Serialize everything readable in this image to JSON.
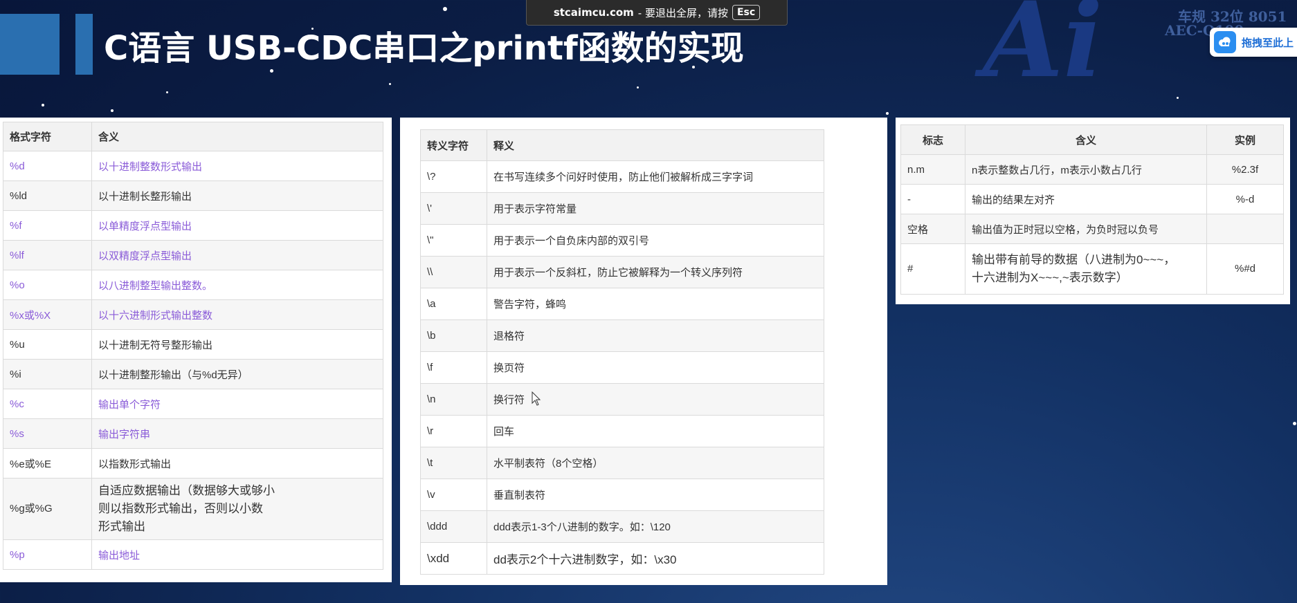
{
  "slide_title": "C语言 USB-CDC串口之printf函数的实现",
  "fullscreen_notice": {
    "domain": "stcaimcu.com",
    "text": "- 要退出全屏，请按",
    "key": "Esc"
  },
  "brand": {
    "big": "Ai",
    "line1": "车规 32位 8051",
    "line2": "AEC-Q100"
  },
  "drag_button": {
    "label": "拖拽至此上",
    "icon": "cloud-icon"
  },
  "format_table": {
    "headers": [
      "格式字符",
      "含义"
    ],
    "rows": [
      {
        "code": "%d",
        "meaning": "以十进制整数形式输出"
      },
      {
        "code": "%ld",
        "meaning": "以十进制长整形输出"
      },
      {
        "code": "%f",
        "meaning": "以单精度浮点型输出"
      },
      {
        "code": "%lf",
        "meaning": "以双精度浮点型输出"
      },
      {
        "code": "%o",
        "meaning": "以八进制整型输出整数。"
      },
      {
        "code": "%x或%X",
        "meaning": "以十六进制形式输出整数"
      },
      {
        "code": "%u",
        "meaning": "以十进制无符号整形输出"
      },
      {
        "code": "%i",
        "meaning": "以十进制整形输出（与%d无异）"
      },
      {
        "code": "%c",
        "meaning": "输出单个字符"
      },
      {
        "code": "%s",
        "meaning": "输出字符串"
      },
      {
        "code": "%e或%E",
        "meaning": "以指数形式输出"
      },
      {
        "code": "%g或%G",
        "meaning_lines": [
          "自适应数据输出（数据够大或够小",
          "则以指数形式输出，否则以小数",
          "形式输出"
        ]
      },
      {
        "code": "%p",
        "meaning": "输出地址"
      }
    ],
    "link_color": "#8a5bd8"
  },
  "escape_table": {
    "headers": [
      "转义字符",
      "释义"
    ],
    "rows": [
      {
        "code": "\\?",
        "meaning": "在书写连续多个问好时使用，防止他们被解析成三字字词"
      },
      {
        "code": "\\'",
        "meaning": "用于表示字符常量"
      },
      {
        "code": "\\\"",
        "meaning": "用于表示一个自负床内部的双引号"
      },
      {
        "code": "\\\\",
        "meaning": "用于表示一个反斜杠，防止它被解释为一个转义序列符"
      },
      {
        "code": "\\a",
        "meaning": "警告字符，蜂鸣"
      },
      {
        "code": "\\b",
        "meaning": "退格符"
      },
      {
        "code": "\\f",
        "meaning": "换页符"
      },
      {
        "code": "\\n",
        "meaning": "换行符"
      },
      {
        "code": "\\r",
        "meaning": "回车"
      },
      {
        "code": "\\t",
        "meaning": "水平制表符（8个空格）"
      },
      {
        "code": "\\v",
        "meaning": "垂直制表符"
      },
      {
        "code": "\\ddd",
        "meaning": "ddd表示1-3个八进制的数字。如：\\120"
      },
      {
        "code": "\\xdd",
        "meaning": "dd表示2个十六进制数字，如：\\x30"
      }
    ]
  },
  "flag_table": {
    "headers": [
      "标志",
      "含义",
      "实例"
    ],
    "rows": [
      {
        "flag": "n.m",
        "meaning": "n表示整数占几行，m表示小数占几行",
        "example": "%2.3f"
      },
      {
        "flag": "-",
        "meaning": "输出的结果左对齐",
        "example": "%-d"
      },
      {
        "flag": "空格",
        "meaning": "输出值为正时冠以空格，为负时冠以负号",
        "example": ""
      },
      {
        "flag": "#",
        "meaning_lines": [
          "输出带有前导的数据（八进制为0~~~，",
          "十六进制为X~~~,~表示数字）"
        ],
        "example": "%#d"
      }
    ]
  }
}
